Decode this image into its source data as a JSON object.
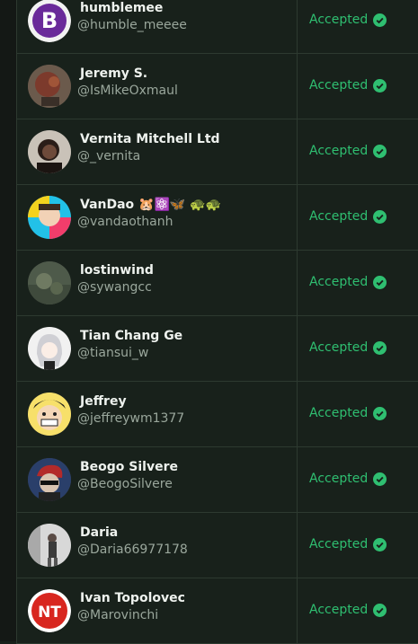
{
  "rows": [
    {
      "name": "humblemee",
      "handle": "@humble_meeee",
      "status": "Accepted"
    },
    {
      "name": "Jeremy S.",
      "handle": "@IsMikeOxmaul",
      "status": "Accepted"
    },
    {
      "name": "Vernita Mitchell Ltd",
      "handle": "@_vernita",
      "status": "Accepted"
    },
    {
      "name": "VanDao 🐹⚛️🦋 🐢🐢",
      "handle": "@vandaothanh",
      "status": "Accepted"
    },
    {
      "name": "lostinwind",
      "handle": "@sywangcc",
      "status": "Accepted"
    },
    {
      "name": "Tian Chang Ge",
      "handle": "@tiansui_w",
      "status": "Accepted"
    },
    {
      "name": "Jeffrey",
      "handle": "@jeffreywm1377",
      "status": "Accepted"
    },
    {
      "name": "Beogo Silvere",
      "handle": "@BeogoSilvere",
      "status": "Accepted"
    },
    {
      "name": "Daria",
      "handle": "@Daria66977178",
      "status": "Accepted"
    },
    {
      "name": "Ivan Topolovec",
      "handle": "@Marovinchi",
      "status": "Accepted"
    }
  ],
  "colors": {
    "accepted": "#2fbf71",
    "background": "#18211b",
    "border": "#2d3a30"
  },
  "icons": {
    "status": "check-circle-icon"
  }
}
